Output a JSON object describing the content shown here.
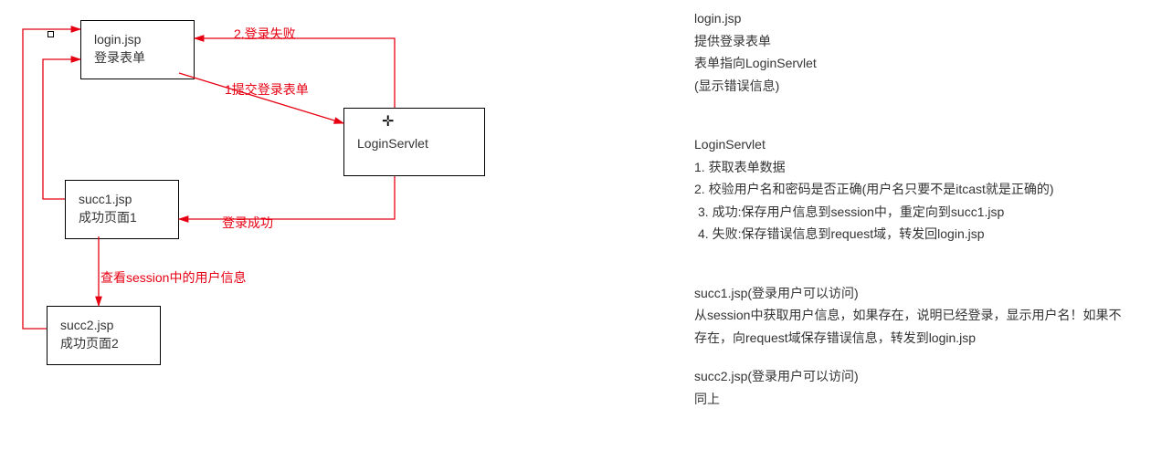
{
  "boxes": {
    "login": {
      "title": "login.jsp",
      "sub": "登录表单"
    },
    "servlet": {
      "title": "LoginServlet"
    },
    "succ1": {
      "title": "succ1.jsp",
      "sub": "成功页面1"
    },
    "succ2": {
      "title": "succ2.jsp",
      "sub": "成功页面2"
    }
  },
  "edge_labels": {
    "fail": "2.登录失败",
    "submit": "1提交登录表单",
    "success": "登录成功",
    "viewSession": "查看session中的用户信息"
  },
  "right": {
    "login": {
      "h": "login.jsp",
      "l1": "提供登录表单",
      "l2": "表单指向LoginServlet",
      "l3": "(显示错误信息)"
    },
    "servlet": {
      "h": "LoginServlet",
      "l1": "1. 获取表单数据",
      "l2": "2. 校验用户名和密码是否正确(用户名只要不是itcast就是正确的)",
      "l3": " 3. 成功:保存用户信息到session中，重定向到succ1.jsp",
      "l4": " 4. 失败:保存错误信息到request域，转发回login.jsp"
    },
    "succ1": {
      "h": "succ1.jsp(登录用户可以访问)",
      "l1": "从session中获取用户信息，如果存在，说明已经登录，显示用户名！如果不存在，向request域保存错误信息，转发到login.jsp"
    },
    "succ2": {
      "h": "succ2.jsp(登录用户可以访问)",
      "l1": "同上"
    }
  },
  "chart_data": {
    "type": "diagram",
    "nodes": [
      {
        "id": "login",
        "title": "login.jsp",
        "subtitle": "登录表单"
      },
      {
        "id": "servlet",
        "title": "LoginServlet"
      },
      {
        "id": "succ1",
        "title": "succ1.jsp",
        "subtitle": "成功页面1"
      },
      {
        "id": "succ2",
        "title": "succ2.jsp",
        "subtitle": "成功页面2"
      }
    ],
    "edges": [
      {
        "from": "login",
        "to": "servlet",
        "label": "1提交登录表单"
      },
      {
        "from": "servlet",
        "to": "login",
        "label": "2.登录失败"
      },
      {
        "from": "servlet",
        "to": "succ1",
        "label": "登录成功"
      },
      {
        "from": "succ1",
        "to": "succ2",
        "label": "查看session中的用户信息"
      },
      {
        "from": "succ1",
        "to": "login",
        "label": ""
      },
      {
        "from": "succ2",
        "to": "login",
        "label": ""
      }
    ]
  }
}
